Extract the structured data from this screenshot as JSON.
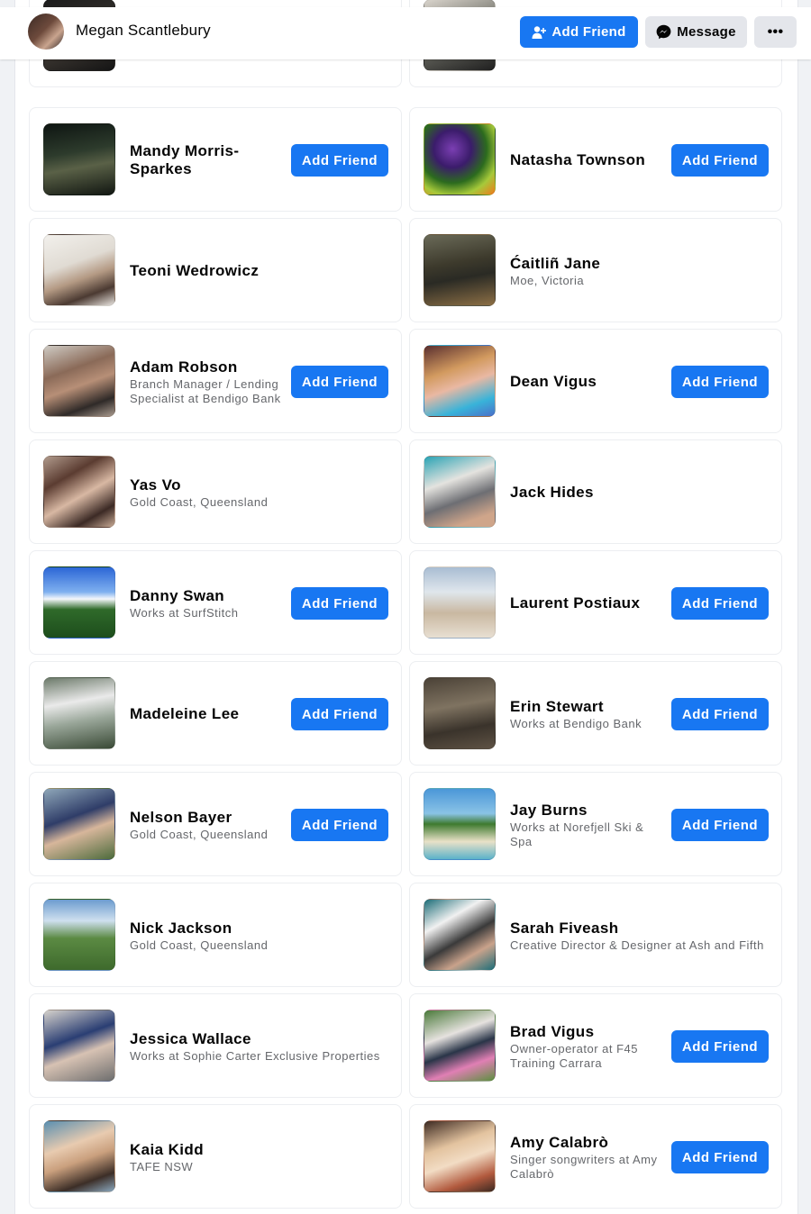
{
  "header": {
    "profile_name": "Megan Scantlebury",
    "add_friend_label": "Add Friend",
    "message_label": "Message",
    "more_label": "•••"
  },
  "friends": [
    {
      "name": "",
      "subtitle": "",
      "button": "Add Friend"
    },
    {
      "name": "",
      "subtitle": "",
      "button": "Add Friend"
    },
    {
      "name": "Mandy Morris-Sparkes",
      "subtitle": "",
      "button": "Add Friend"
    },
    {
      "name": "Natasha Townson",
      "subtitle": "",
      "button": "Add Friend"
    },
    {
      "name": "Teoni Wedrowicz",
      "subtitle": "",
      "button": ""
    },
    {
      "name": "Ćaitliñ Jane",
      "subtitle": "Moe, Victoria",
      "button": ""
    },
    {
      "name": "Adam Robson",
      "subtitle": "Branch Manager / Lending Specialist at Bendigo Bank",
      "button": "Add Friend"
    },
    {
      "name": "Dean Vigus",
      "subtitle": "",
      "button": "Add Friend"
    },
    {
      "name": "Yas Vo",
      "subtitle": "Gold Coast, Queensland",
      "button": ""
    },
    {
      "name": "Jack Hides",
      "subtitle": "",
      "button": ""
    },
    {
      "name": "Danny Swan",
      "subtitle": "Works at SurfStitch",
      "button": "Add Friend"
    },
    {
      "name": "Laurent Postiaux",
      "subtitle": "",
      "button": "Add Friend"
    },
    {
      "name": "Madeleine Lee",
      "subtitle": "",
      "button": "Add Friend"
    },
    {
      "name": "Erin Stewart",
      "subtitle": "Works at Bendigo Bank",
      "button": "Add Friend"
    },
    {
      "name": "Nelson Bayer",
      "subtitle": "Gold Coast, Queensland",
      "button": "Add Friend"
    },
    {
      "name": "Jay Burns",
      "subtitle": "Works at Norefjell Ski & Spa",
      "button": "Add Friend"
    },
    {
      "name": "Nick Jackson",
      "subtitle": "Gold Coast, Queensland",
      "button": ""
    },
    {
      "name": "Sarah Fiveash",
      "subtitle": "Creative Director & Designer at Ash and Fifth",
      "button": ""
    },
    {
      "name": "Jessica Wallace",
      "subtitle": "Works at Sophie Carter Exclusive Properties",
      "button": ""
    },
    {
      "name": "Brad Vigus",
      "subtitle": "Owner-operator at F45 Training Carrara",
      "button": "Add Friend"
    },
    {
      "name": "Kaia Kidd",
      "subtitle": "TAFE NSW",
      "button": ""
    },
    {
      "name": "Amy Calabrò",
      "subtitle": "Singer songwriters at Amy Calabrò",
      "button": "Add Friend"
    }
  ]
}
